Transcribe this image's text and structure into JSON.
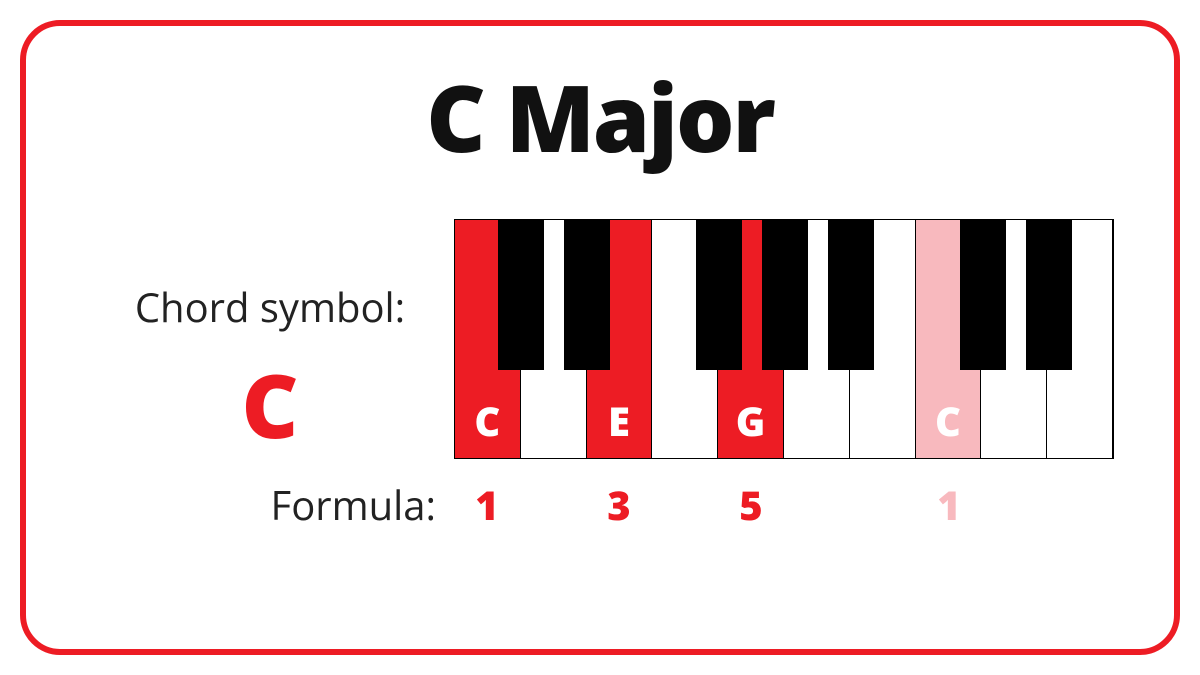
{
  "title": "C Major",
  "chord_symbol_label": "Chord symbol:",
  "chord_symbol": "C",
  "formula_label": "Formula:",
  "colors": {
    "accent": "#ed1c24",
    "accent_soft": "#f8b9be"
  },
  "white_keys": [
    {
      "note": "C",
      "highlight": "strong",
      "label": "C"
    },
    {
      "note": "D",
      "highlight": "none",
      "label": ""
    },
    {
      "note": "E",
      "highlight": "strong",
      "label": "E"
    },
    {
      "note": "F",
      "highlight": "none",
      "label": ""
    },
    {
      "note": "G",
      "highlight": "strong",
      "label": "G"
    },
    {
      "note": "A",
      "highlight": "none",
      "label": ""
    },
    {
      "note": "B",
      "highlight": "none",
      "label": ""
    },
    {
      "note": "C",
      "highlight": "soft",
      "label": "C"
    },
    {
      "note": "D",
      "highlight": "none",
      "label": ""
    },
    {
      "note": "E",
      "highlight": "none",
      "label": ""
    }
  ],
  "black_keys_after_white_index": [
    0,
    1,
    3,
    4,
    5,
    7,
    8
  ],
  "formula": [
    {
      "value": "1",
      "style": "red"
    },
    {
      "value": "",
      "style": ""
    },
    {
      "value": "3",
      "style": "red"
    },
    {
      "value": "",
      "style": ""
    },
    {
      "value": "5",
      "style": "red"
    },
    {
      "value": "",
      "style": ""
    },
    {
      "value": "",
      "style": ""
    },
    {
      "value": "1",
      "style": "soft"
    },
    {
      "value": "",
      "style": ""
    },
    {
      "value": "",
      "style": ""
    }
  ]
}
